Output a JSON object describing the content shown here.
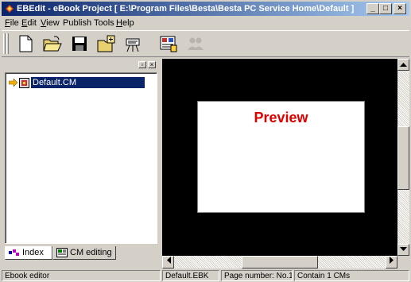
{
  "window": {
    "title": "EBEdit - eBook Project [ E:\\Program Files\\Besta\\Besta PC Service Home\\Default ]",
    "controls": {
      "minimize": "_",
      "maximize": "□",
      "close": "×"
    }
  },
  "menu": {
    "file": {
      "mnemonic": "F",
      "rest": "ile"
    },
    "edit": {
      "mnemonic": "E",
      "rest": "dit"
    },
    "view": {
      "mnemonic": "V",
      "rest": "iew"
    },
    "publish": {
      "label": "Publish"
    },
    "tools": {
      "label": "Tools"
    },
    "help": {
      "mnemonic": "H",
      "rest": "elp"
    }
  },
  "toolbar": {
    "icons": [
      "new-document-icon",
      "open-folder-icon",
      "save-disk-icon",
      "new-page-icon",
      "preview-icon",
      "publish-icon",
      "users-icon"
    ]
  },
  "left_pane": {
    "controls": {
      "restore": "▫",
      "close": "×"
    },
    "tree": {
      "items": [
        {
          "label": "Default.CM",
          "selected": true
        }
      ]
    },
    "tabs": [
      {
        "label": "Index",
        "active": true
      },
      {
        "label": "CM editing",
        "active": false
      }
    ]
  },
  "preview": {
    "title": "Preview",
    "title_color": "#e00000"
  },
  "status": {
    "mode": "Ebook editor",
    "file": "Default.EBK",
    "page": "Page number: No.1",
    "count": "Contain 1 CMs"
  },
  "colors": {
    "titlebar_start": "#0a246a",
    "titlebar_end": "#a6caf0",
    "selection": "#0a246a",
    "face": "#d4d0c8"
  }
}
